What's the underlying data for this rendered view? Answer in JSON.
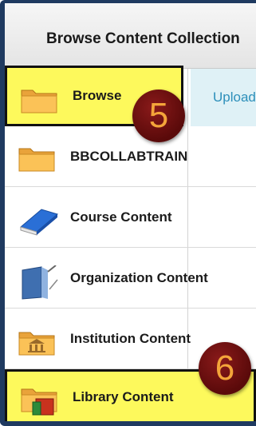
{
  "header": {
    "title": "Browse Content Collection"
  },
  "upload": {
    "label": "Upload"
  },
  "sidebar": {
    "items": [
      {
        "label": "Browse",
        "icon": "folder-icon"
      },
      {
        "label": "BBCOLLABTRAIN",
        "icon": "folder-icon"
      },
      {
        "label": "Course Content",
        "icon": "book-icon"
      },
      {
        "label": "Organization Content",
        "icon": "binder-icon"
      },
      {
        "label": "Institution Content",
        "icon": "institution-folder-icon"
      },
      {
        "label": "Library Content",
        "icon": "library-folder-icon"
      }
    ]
  },
  "callouts": {
    "step5": "5",
    "step6": "6"
  },
  "colors": {
    "highlight": "#fdf95c",
    "badge": "#6e1010",
    "badge_text": "#f4a53a",
    "link": "#2c8fba"
  }
}
